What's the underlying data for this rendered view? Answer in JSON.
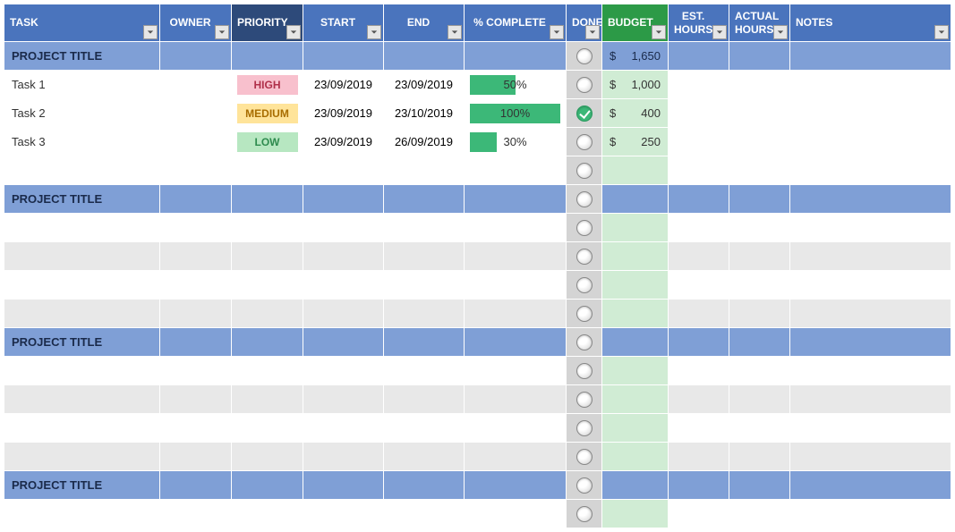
{
  "headers": {
    "task": "TASK",
    "owner": "OWNER",
    "priority": "PRIORITY",
    "start": "START",
    "end": "END",
    "pct": "% COMPLETE",
    "done": "DONE",
    "budget": "BUDGET",
    "est": "EST. HOURS",
    "act": "ACTUAL HOURS",
    "notes": "NOTES"
  },
  "sections": [
    {
      "title": "PROJECT TITLE",
      "budget_sym": "$",
      "budget_val": "1,650",
      "tasks": [
        {
          "name": "Task 1",
          "owner": "",
          "priority": "HIGH",
          "prio_cls": "high",
          "start": "23/09/2019",
          "end": "23/09/2019",
          "pct": 50,
          "pct_label": "50%",
          "done": false,
          "budget_sym": "$",
          "budget_val": "1,000",
          "est": "",
          "act": "",
          "notes": ""
        },
        {
          "name": "Task 2",
          "owner": "",
          "priority": "MEDIUM",
          "prio_cls": "medium",
          "start": "23/09/2019",
          "end": "23/10/2019",
          "pct": 100,
          "pct_label": "100%",
          "done": true,
          "budget_sym": "$",
          "budget_val": "400",
          "est": "",
          "act": "",
          "notes": ""
        },
        {
          "name": "Task 3",
          "owner": "",
          "priority": "LOW",
          "prio_cls": "low",
          "start": "23/09/2019",
          "end": "26/09/2019",
          "pct": 30,
          "pct_label": "30%",
          "done": false,
          "budget_sym": "$",
          "budget_val": "250",
          "est": "",
          "act": "",
          "notes": ""
        }
      ],
      "empty_rows": 1
    },
    {
      "title": "PROJECT TITLE",
      "budget_sym": "",
      "budget_val": "",
      "tasks": [],
      "empty_rows": 4
    },
    {
      "title": "PROJECT TITLE",
      "budget_sym": "",
      "budget_val": "",
      "tasks": [],
      "empty_rows": 4
    },
    {
      "title": "PROJECT TITLE",
      "budget_sym": "",
      "budget_val": "",
      "tasks": [],
      "empty_rows": 1
    }
  ]
}
